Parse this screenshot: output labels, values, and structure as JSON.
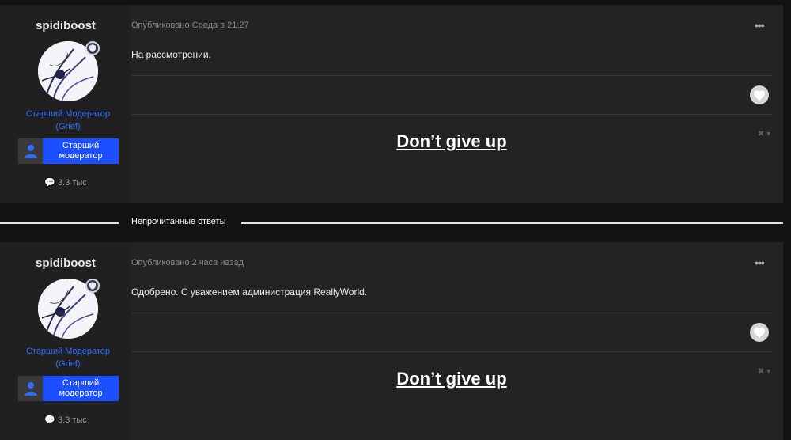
{
  "posts": [
    {
      "author": "spidiboost",
      "role_line1": "Старший Модератор",
      "role_line2": "(Grief)",
      "rank_label_line1": "Старший",
      "rank_label_line2": "модератор",
      "stat_text": "3.3 тыс",
      "published": "Опубликовано Среда в 21:27",
      "content": "На рассмотрении.",
      "signature": "Don’t give up",
      "menu_icon": "ellipsis-icon",
      "like_icon": "heart-icon"
    },
    {
      "author": "spidiboost",
      "role_line1": "Старший Модератор",
      "role_line2": "(Grief)",
      "rank_label_line1": "Старший",
      "rank_label_line2": "модератор",
      "stat_text": "3.3 тыс",
      "published": "Опубликовано 2 часа назад",
      "content": "Одобрено. С уважением администрация ReallyWorld.",
      "signature": "Don’t give up",
      "menu_icon": "ellipsis-icon",
      "like_icon": "heart-icon"
    }
  ],
  "unread_divider": {
    "label": "Непрочитанные ответы"
  },
  "colors": {
    "page_bg": "#121212",
    "post_bg": "#232323",
    "role_color": "#2f6bff",
    "rank_bg": "#1c4fff"
  }
}
